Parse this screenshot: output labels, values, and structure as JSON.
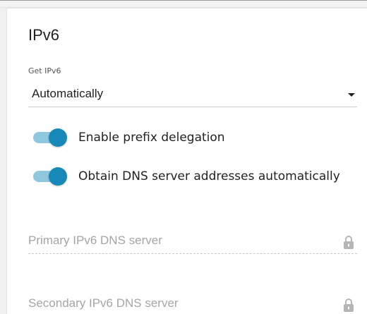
{
  "section": {
    "title": "IPv6"
  },
  "get_ipv6": {
    "caption": "Get IPv6",
    "selected": "Automatically"
  },
  "toggles": [
    {
      "label": "Enable prefix delegation",
      "enabled": true
    },
    {
      "label": "Obtain DNS server addresses automatically",
      "enabled": true
    }
  ],
  "dns_fields": [
    {
      "placeholder": "Primary IPv6 DNS server",
      "value": "",
      "locked": true,
      "icon": "lock-icon"
    },
    {
      "placeholder": "Secondary IPv6 DNS server",
      "value": "",
      "locked": true,
      "icon": "lock-icon"
    }
  ],
  "colors": {
    "switch_knob": "#1789b8",
    "switch_track": "#8fc7df",
    "text": "#222222",
    "placeholder": "#a5a5a5",
    "lock": "#b5b5b5"
  }
}
